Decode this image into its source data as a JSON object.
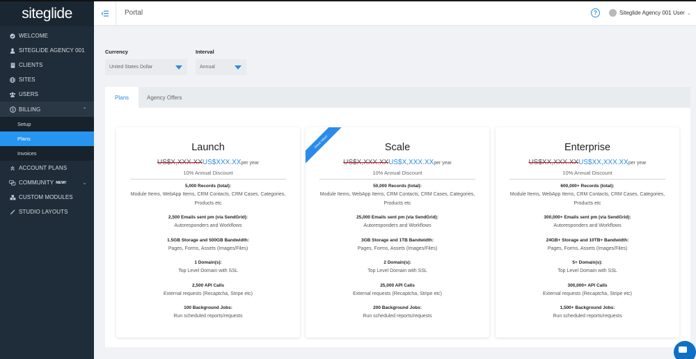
{
  "brand": {
    "logo_text": "siteglide",
    "accent": "#2a8ce8"
  },
  "sidebar": {
    "items": [
      {
        "label": "WELCOME",
        "icon": "check-circle-icon"
      },
      {
        "label": "SITEGLIDE AGENCY 001",
        "icon": "user-icon"
      },
      {
        "label": "CLIENTS",
        "icon": "building-icon"
      },
      {
        "label": "SITES",
        "icon": "globe-icon"
      },
      {
        "label": "USERS",
        "icon": "users-icon"
      },
      {
        "label": "BILLING",
        "icon": "dollar-icon"
      }
    ],
    "billing_sub": [
      {
        "label": "Setup"
      },
      {
        "label": "Plans"
      },
      {
        "label": "Invoices"
      }
    ],
    "items_after": [
      {
        "label": "ACCOUNT PLANS",
        "icon": "double-chevron-up-icon"
      },
      {
        "label": "COMMUNITY",
        "badge": "NEW!",
        "icon": "chat-icon"
      },
      {
        "label": "CUSTOM MODULES",
        "icon": "cubes-icon"
      },
      {
        "label": "STUDIO LAYOUTS",
        "icon": "brush-icon"
      }
    ]
  },
  "header": {
    "title": "Portal",
    "user_name": "Siteglide Agency 001 User"
  },
  "filters": {
    "currency_label": "Currency",
    "currency_value": "United States Dollar",
    "interval_label": "Interval",
    "interval_value": "Annual"
  },
  "tabs": [
    {
      "label": "Plans"
    },
    {
      "label": "Agency Offers"
    }
  ],
  "plans": [
    {
      "name": "Launch",
      "old_price": "US$X,XXX.XX",
      "new_price": "US$XXX.XX",
      "per": "per year",
      "discount": "10% Annual Discount",
      "ribbon": "",
      "features": [
        {
          "title": "5,000 Records (total):",
          "desc": "Module Items, WebApp Items, CRM Contacts, CRM Cases, Categories, Products etc"
        },
        {
          "title": "2,500 Emails sent pm (via SendGrid):",
          "desc": "Autoresponders and Workflows"
        },
        {
          "title": "1.5GB Storage and 500GB Bandwidth:",
          "desc": "Pages, Forms, Assets (Images/Files)"
        },
        {
          "title": "1 Domain(s):",
          "desc": "Top Level Domain with SSL"
        },
        {
          "title": "2,500 API Calls",
          "desc": "External requests (Recaptcha, Stripe etc)"
        },
        {
          "title": "100 Background Jobs:",
          "desc": "Run scheduled reports/requests"
        }
      ]
    },
    {
      "name": "Scale",
      "old_price": "US$X,XXX.XX",
      "new_price": "US$X,XXX.XX",
      "per": "per year",
      "discount": "10% Annual Discount",
      "ribbon": "Great Value!",
      "features": [
        {
          "title": "50,000 Records (total):",
          "desc": "Module Items, WebApp Items, CRM Contacts, CRM Cases, Categories, Products etc"
        },
        {
          "title": "25,000 Emails sent pm (via SendGrid):",
          "desc": "Autoresponders and Workflows"
        },
        {
          "title": "3GB Storage and 1TB Bandwidth:",
          "desc": "Pages, Forms, Assets (Images/Files)"
        },
        {
          "title": "2 Domain(s):",
          "desc": "Top Level Domain with SSL"
        },
        {
          "title": "25,000 API Calls",
          "desc": "External requests (Recaptcha, Stripe etc)"
        },
        {
          "title": "200 Background Jobs:",
          "desc": "Run scheduled reports/requests"
        }
      ]
    },
    {
      "name": "Enterprise",
      "old_price": "US$XX,XXX.XX",
      "new_price": "US$XX,XXX.XX",
      "per": "per year",
      "discount": "10% Annual Discount",
      "ribbon": "",
      "features": [
        {
          "title": "600,000+ Records (total):",
          "desc": "Module Items, WebApp Items, CRM Contacts, CRM Cases, Categories, Products etc"
        },
        {
          "title": "300,000+ Emails sent pm (via SendGrid):",
          "desc": "Autoresponders and Workflows"
        },
        {
          "title": "24GB+ Storage and 10TB+ Bandwidth:",
          "desc": "Pages, Forms, Assets (Images/Files)"
        },
        {
          "title": "5+ Domain(s):",
          "desc": "Top Level Domain with SSL"
        },
        {
          "title": "300,000+ API Calls",
          "desc": "External requests (Recaptcha, Stripe etc)"
        },
        {
          "title": "1,500+ Background Jobs:",
          "desc": "Run scheduled reports/requests"
        }
      ]
    }
  ]
}
